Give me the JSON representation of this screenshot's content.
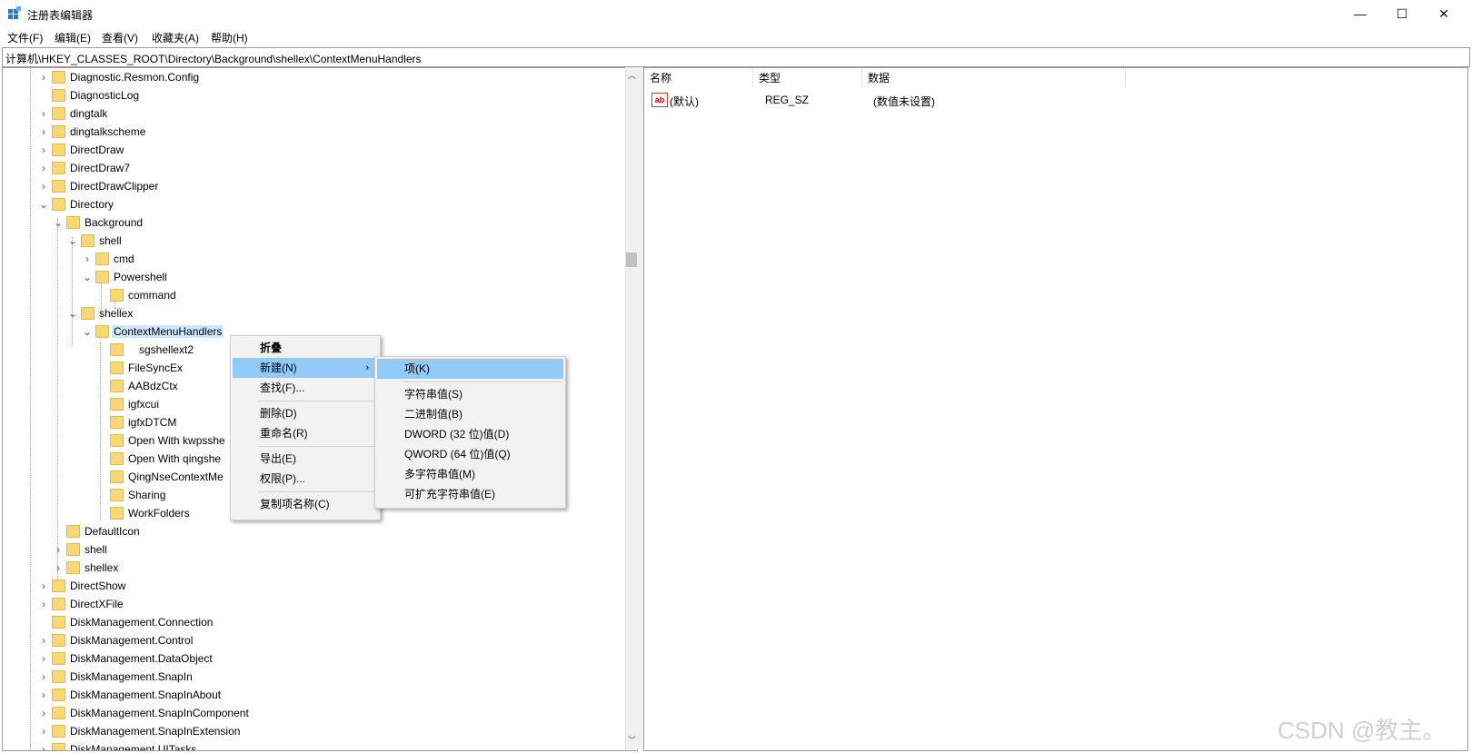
{
  "window": {
    "title": "注册表编辑器",
    "minimize": "—",
    "maximize": "☐",
    "close": "✕"
  },
  "menubar": [
    "文件(F)",
    "编辑(E)",
    "查看(V)",
    "收藏夹(A)",
    "帮助(H)"
  ],
  "address": "计算机\\HKEY_CLASSES_ROOT\\Directory\\Background\\shellex\\ContextMenuHandlers",
  "tree": [
    {
      "label": "Diagnostic.Resmon.Config",
      "arrow": "›"
    },
    {
      "label": "DiagnosticLog",
      "arrow": ""
    },
    {
      "label": "dingtalk",
      "arrow": "›"
    },
    {
      "label": "dingtalkscheme",
      "arrow": "›"
    },
    {
      "label": "DirectDraw",
      "arrow": "›"
    },
    {
      "label": "DirectDraw7",
      "arrow": "›"
    },
    {
      "label": "DirectDrawClipper",
      "arrow": "›"
    },
    {
      "label": "Directory",
      "arrow": "⌄"
    },
    {
      "label": "Background",
      "arrow": "⌄"
    },
    {
      "label": "shell",
      "arrow": "⌄"
    },
    {
      "label": "cmd",
      "arrow": "›"
    },
    {
      "label": "Powershell",
      "arrow": "⌄"
    },
    {
      "label": "command",
      "arrow": ""
    },
    {
      "label": "shellex",
      "arrow": "⌄"
    },
    {
      "label": "ContextMenuHandlers",
      "arrow": "⌄"
    },
    {
      "label": "sgshellext2",
      "arrow": ""
    },
    {
      "label": "FileSyncEx",
      "arrow": ""
    },
    {
      "label": "AABdzCtx",
      "arrow": ""
    },
    {
      "label": "igfxcui",
      "arrow": ""
    },
    {
      "label": "igfxDTCM",
      "arrow": ""
    },
    {
      "label": "Open With kwpsshe",
      "arrow": ""
    },
    {
      "label": "Open With qingshe",
      "arrow": ""
    },
    {
      "label": "QingNseContextMe",
      "arrow": ""
    },
    {
      "label": "Sharing",
      "arrow": ""
    },
    {
      "label": "WorkFolders",
      "arrow": ""
    },
    {
      "label": "DefaultIcon",
      "arrow": ""
    },
    {
      "label": "shell",
      "arrow": "›"
    },
    {
      "label": "shellex",
      "arrow": "›"
    },
    {
      "label": "DirectShow",
      "arrow": "›"
    },
    {
      "label": "DirectXFile",
      "arrow": "›"
    },
    {
      "label": "DiskManagement.Connection",
      "arrow": ""
    },
    {
      "label": "DiskManagement.Control",
      "arrow": "›"
    },
    {
      "label": "DiskManagement.DataObject",
      "arrow": "›"
    },
    {
      "label": "DiskManagement.SnapIn",
      "arrow": "›"
    },
    {
      "label": "DiskManagement.SnapInAbout",
      "arrow": "›"
    },
    {
      "label": "DiskManagement.SnapInComponent",
      "arrow": "›"
    },
    {
      "label": "DiskManagement.SnapInExtension",
      "arrow": "›"
    },
    {
      "label": "DiskManagement.UITasks",
      "arrow": "›"
    }
  ],
  "list": {
    "columns": [
      "名称",
      "类型",
      "数据"
    ],
    "rows": [
      {
        "icon": "ab",
        "name": "(默认)",
        "type": "REG_SZ",
        "data": "(数值未设置)"
      }
    ]
  },
  "context_menu": {
    "items": [
      "折叠",
      "新建(N)",
      "查找(F)...",
      "删除(D)",
      "重命名(R)",
      "导出(E)",
      "权限(P)...",
      "复制项名称(C)"
    ],
    "submenu_arrow": "›"
  },
  "submenu": {
    "items": [
      "项(K)",
      "字符串值(S)",
      "二进制值(B)",
      "DWORD (32 位)值(D)",
      "QWORD (64 位)值(Q)",
      "多字符串值(M)",
      "可扩充字符串值(E)"
    ]
  },
  "scroll": {
    "up": "︿",
    "down": "﹀"
  },
  "watermark": "CSDN @教主。"
}
